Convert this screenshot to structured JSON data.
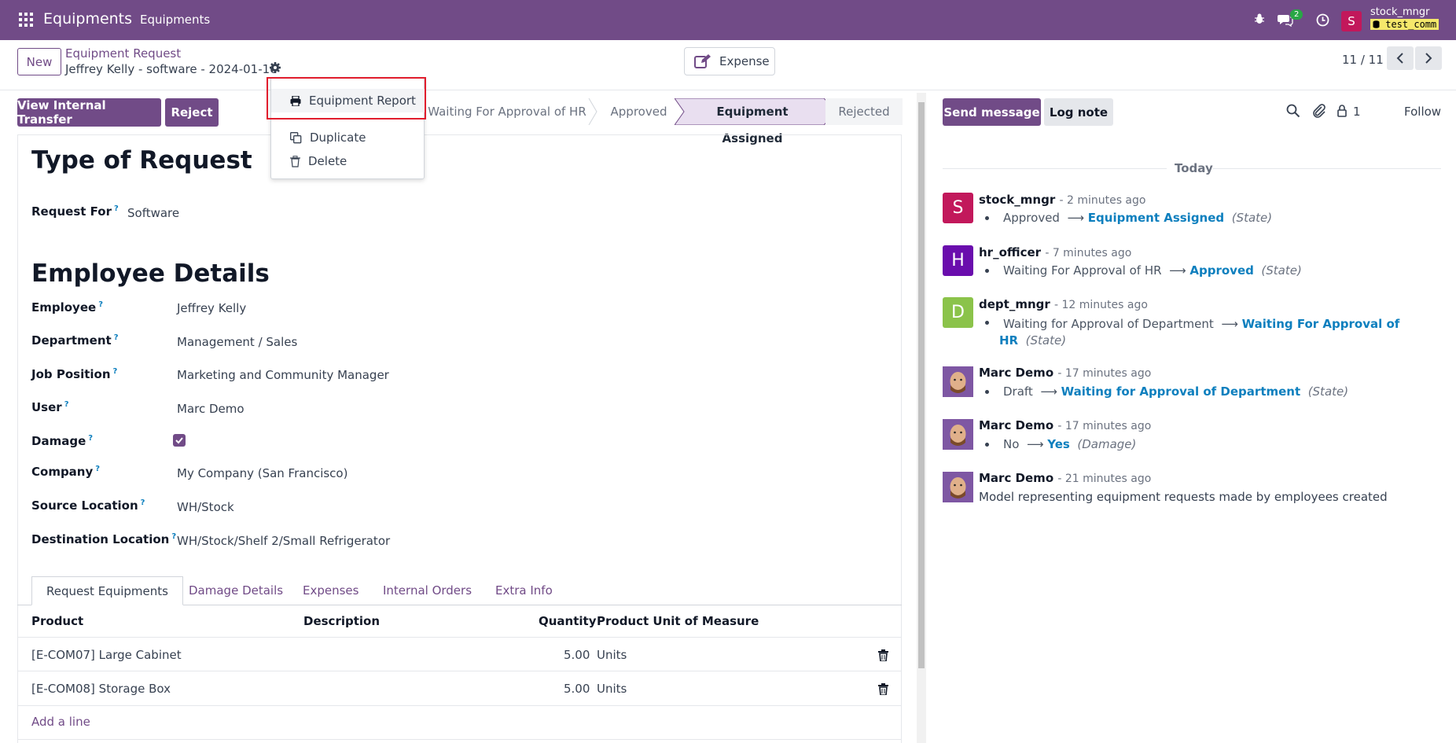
{
  "navbar": {
    "app_name": "Equipments",
    "menu_item": "Equipments",
    "messages_badge": "2",
    "user_initial": "S",
    "user_name": "stock_mngr",
    "db_name": "test_comm"
  },
  "control_panel": {
    "new_label": "New",
    "breadcrumb_parent": "Equipment Request",
    "breadcrumb_current": "Jeffrey Kelly - software - 2024-01-16",
    "expense_label": "Expense",
    "pager": "11 / 11"
  },
  "actions_menu": {
    "items": [
      {
        "label": "Equipment Report",
        "icon": "printer-icon"
      },
      {
        "label": "Duplicate",
        "icon": "copy-icon"
      },
      {
        "label": "Delete",
        "icon": "trash-icon"
      }
    ]
  },
  "statusbar": {
    "buttons": [
      "View Internal Transfer",
      "Reject"
    ],
    "stages": [
      "Waiting For Approval of HR",
      "Approved",
      "Equipment Assigned",
      "Rejected"
    ],
    "active_stage": "Equipment Assigned"
  },
  "form": {
    "section1_title": "Type of Request",
    "request_for_label": "Request For",
    "request_for_value": "Software",
    "section2_title": "Employee Details",
    "fields": [
      {
        "label": "Employee",
        "value": "Jeffrey Kelly"
      },
      {
        "label": "Department",
        "value": "Management / Sales"
      },
      {
        "label": "Job Position",
        "value": "Marketing and Community Manager"
      },
      {
        "label": "User",
        "value": "Marc Demo"
      },
      {
        "label": "Damage",
        "value": ""
      },
      {
        "label": "Company",
        "value": "My Company (San Francisco)"
      },
      {
        "label": "Source Location",
        "value": "WH/Stock"
      },
      {
        "label": "Destination Location",
        "value": "WH/Stock/Shelf 2/Small Refrigerator"
      }
    ],
    "damage_checked": true,
    "help_mark": "?"
  },
  "tabs": [
    "Request Equipments",
    "Damage Details",
    "Expenses",
    "Internal Orders",
    "Extra Info"
  ],
  "table": {
    "headers": [
      "Product",
      "Description",
      "Quantity",
      "Product Unit of Measure"
    ],
    "rows": [
      {
        "product": "[E-COM07] Large Cabinet",
        "description": "",
        "quantity": "5.00",
        "uom": "Units"
      },
      {
        "product": "[E-COM08] Storage Box",
        "description": "",
        "quantity": "5.00",
        "uom": "Units"
      }
    ],
    "add_line": "Add a line"
  },
  "chatter": {
    "send_label": "Send message",
    "log_label": "Log note",
    "followers_count": "1",
    "follow_label": "Follow",
    "today_label": "Today",
    "arrow": "⟶",
    "messages": [
      {
        "initial": "S",
        "color": "#c2185b",
        "author": "stock_mngr",
        "time": "- 2 minutes ago",
        "old": "Approved",
        "new": "Equipment Assigned",
        "field": "(State)"
      },
      {
        "initial": "H",
        "color": "#6a0dad",
        "author": "hr_officer",
        "time": "- 7 minutes ago",
        "old": "Waiting For Approval of HR",
        "new": "Approved",
        "field": "(State)"
      },
      {
        "initial": "D",
        "color": "#8bc34a",
        "author": "dept_mngr",
        "time": "- 12 minutes ago",
        "old": "Waiting for Approval of Department",
        "new": "Waiting For Approval of",
        "new2": "HR",
        "field": "(State)"
      },
      {
        "initial": "",
        "color": "#6b4e9b",
        "author": "Marc Demo",
        "time": "- 17 minutes ago",
        "old": "Draft",
        "new": "Waiting for Approval of Department",
        "field": "(State)"
      },
      {
        "initial": "",
        "color": "#6b4e9b",
        "author": "Marc Demo",
        "time": "- 17 minutes ago",
        "old": "No",
        "new": "Yes",
        "field": "(Damage)"
      },
      {
        "initial": "",
        "color": "#6b4e9b",
        "author": "Marc Demo",
        "time": "- 21 minutes ago",
        "body": "Model representing equipment requests made by employees created"
      }
    ]
  },
  "colors": {
    "brand": "#714b87",
    "link": "#0d7fbe",
    "highlight_box": "#e11d2d"
  }
}
